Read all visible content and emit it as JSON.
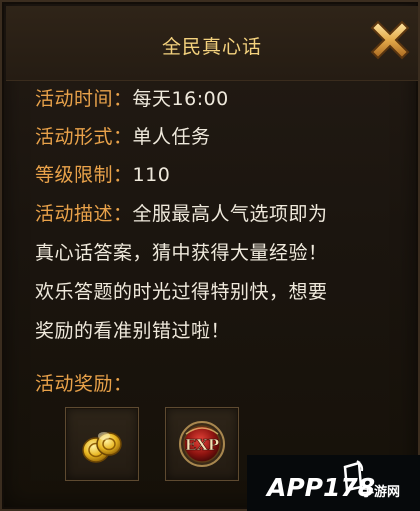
{
  "dialog": {
    "title": "全民真心话",
    "close_icon": "close-x-icon"
  },
  "info": {
    "time_label": "活动时间：",
    "time_value": "每天16:00",
    "form_label": "活动形式：",
    "form_value": "单人任务",
    "level_label": "等级限制：",
    "level_value": "110",
    "desc_label": "活动描述：",
    "desc_line1": "全服最高人气选项即为",
    "desc_line2": "真心话答案，猜中获得大量经验！",
    "desc_line3": "欢乐答题的时光过得特别快，想要",
    "desc_line4": "奖励的看准别错过啦！"
  },
  "rewards": {
    "label": "活动奖励：",
    "items": [
      {
        "icon": "gold-coins-icon"
      },
      {
        "icon": "exp-orb-icon",
        "text": "EXP"
      }
    ]
  },
  "watermark": {
    "text": "APP178",
    "sub": "手游网"
  }
}
